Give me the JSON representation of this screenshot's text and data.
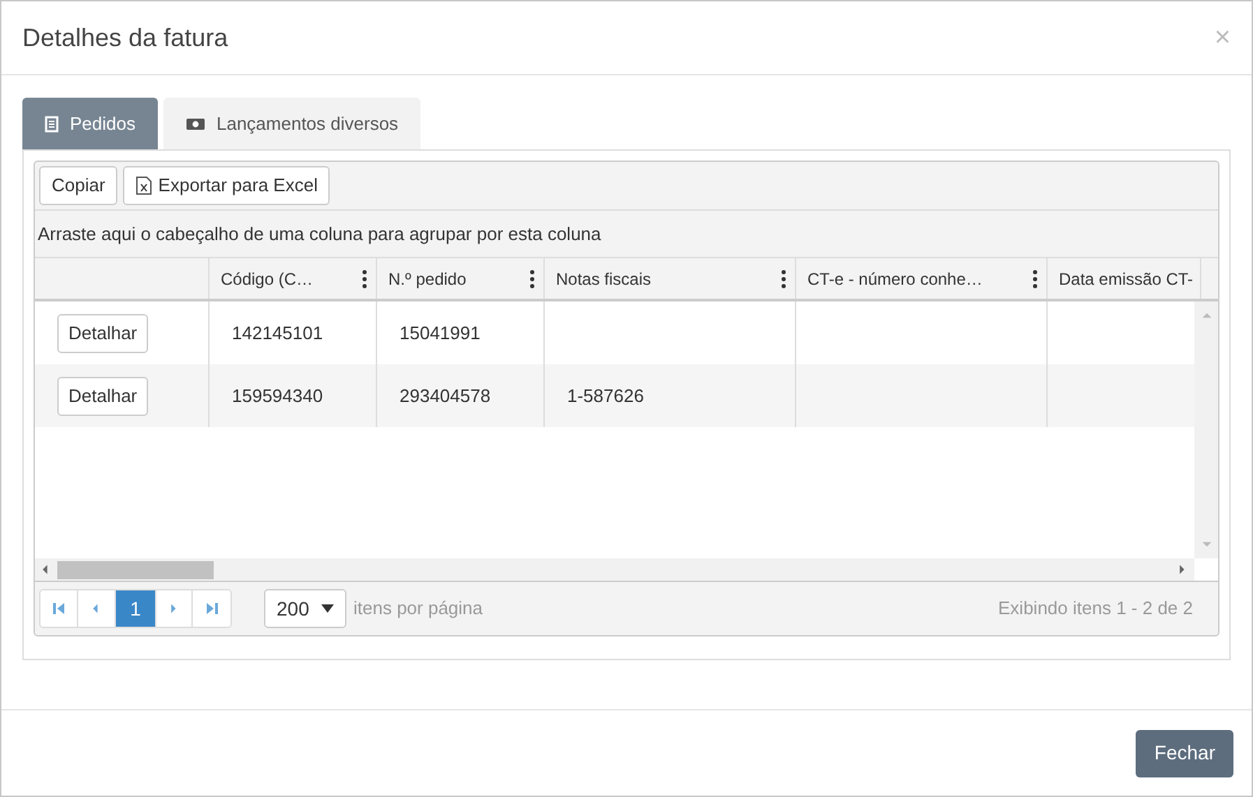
{
  "dialog": {
    "title": "Detalhes da fatura",
    "close": "×"
  },
  "tabs": [
    {
      "label": "Pedidos",
      "selected": true
    },
    {
      "label": "Lançamentos diversos",
      "selected": false
    }
  ],
  "toolbar": [
    {
      "label": "Copiar"
    },
    {
      "label": "Exportar para Excel"
    }
  ],
  "group_hint": "Arraste aqui o cabeçalho de uma coluna para agrupar por esta coluna",
  "columns": [
    {
      "label": "Código (C…",
      "menu": true
    },
    {
      "label": "N.º pedido",
      "menu": true
    },
    {
      "label": "Notas fiscais",
      "menu": true
    },
    {
      "label": "CT-e - número conhe…",
      "menu": true
    },
    {
      "label": "Data emissão CT-"
    }
  ],
  "rows": [
    {
      "action": "Detalhar",
      "cells": [
        "142145101",
        "15041991",
        null,
        null,
        null
      ]
    },
    {
      "action": "Detalhar",
      "cells": [
        "159594340",
        "293404578",
        "1-587626",
        null,
        null
      ]
    }
  ],
  "pager": {
    "pages": [
      {
        "label": "1",
        "selected": true
      }
    ],
    "page_size": "200",
    "page_size_label": "itens por página",
    "summary": "Exibindo itens 1 - 2 de 2"
  },
  "footer": {
    "close_button": "Fechar"
  }
}
